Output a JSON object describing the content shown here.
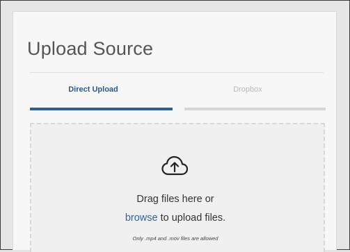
{
  "upload": {
    "title": "Upload Source",
    "tabs": [
      {
        "label": "Direct Upload",
        "active": true
      },
      {
        "label": "Dropbox",
        "active": false
      }
    ],
    "dropzone": {
      "icon": "cloud-upload-icon",
      "drag_text": "Drag files here or",
      "browse_link": "browse",
      "browse_suffix": " to upload files.",
      "note": "Only .mp4 and .mov files are allowed"
    }
  },
  "colors": {
    "accent": "#2b5f93",
    "link": "#2a66a6",
    "inactive_tab": "#d6d6d6"
  }
}
